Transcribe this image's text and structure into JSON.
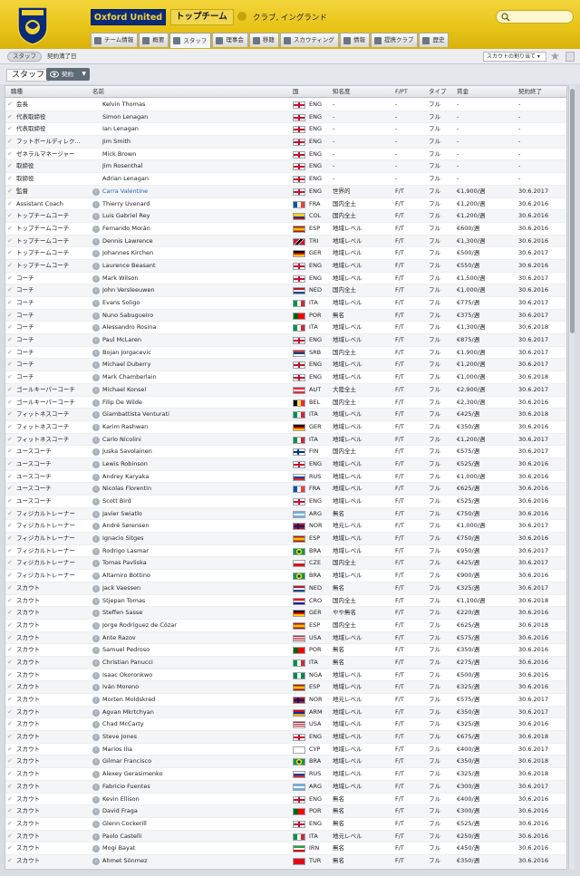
{
  "header": {
    "club_name": "Oxford United",
    "squad": "トップチーム",
    "club_sub": "クラブ, イングランド"
  },
  "tabs": [
    {
      "label": "チーム情報",
      "icon": "team-icon"
    },
    {
      "label": "概要",
      "icon": "overview-icon"
    },
    {
      "label": "スタッフ",
      "icon": "staff-icon",
      "active": true
    },
    {
      "label": "理事会",
      "icon": "board-icon"
    },
    {
      "label": "移籍",
      "icon": "transfer-icon"
    },
    {
      "label": "スカウティング",
      "icon": "scouting-icon"
    },
    {
      "label": "情報",
      "icon": "info-icon"
    },
    {
      "label": "提携クラブ",
      "icon": "affiliate-icon"
    },
    {
      "label": "歴史",
      "icon": "history-icon"
    }
  ],
  "toolbar": {
    "breadcrumb_staff": "スタッフ",
    "breadcrumb_contract": "契約満了日",
    "sort_label": "スカウトの割り当て ▾"
  },
  "page": {
    "title": "スタッフ",
    "view_button": "契約"
  },
  "columns": {
    "role": "職種",
    "name": "名前",
    "nat": "国",
    "rep": "知名度",
    "fp": "F/PT",
    "type": "タイプ",
    "wage": "賃金",
    "exp": "契約終了"
  },
  "colors": {
    "header_yellow": "#e8c418",
    "club_blue": "#0a2b78",
    "link_blue": "#1f5fbf"
  },
  "rows": [
    {
      "role": "会長",
      "name": "Kelvin Thomas",
      "nat": "ENG",
      "rep": "-",
      "fp": "-",
      "type": "フル",
      "wage": "-",
      "exp": "-",
      "info": false
    },
    {
      "role": "代表取締役",
      "name": "Simon Lenagan",
      "nat": "ENG",
      "rep": "-",
      "fp": "-",
      "type": "フル",
      "wage": "-",
      "exp": "-",
      "info": false
    },
    {
      "role": "代表取締役",
      "name": "Ian Lenagan",
      "nat": "ENG",
      "rep": "-",
      "fp": "-",
      "type": "フル",
      "wage": "-",
      "exp": "-",
      "info": false
    },
    {
      "role": "フットボールディレク...",
      "name": "Jim Smith",
      "nat": "ENG",
      "rep": "-",
      "fp": "-",
      "type": "フル",
      "wage": "-",
      "exp": "-",
      "info": false
    },
    {
      "role": "ゼネラルマネージャー",
      "name": "Mick Brown",
      "nat": "ENG",
      "rep": "-",
      "fp": "-",
      "type": "フル",
      "wage": "-",
      "exp": "-",
      "info": false
    },
    {
      "role": "取締役",
      "name": "Jim Rosenthal",
      "nat": "ENG",
      "rep": "-",
      "fp": "-",
      "type": "フル",
      "wage": "-",
      "exp": "-",
      "info": false
    },
    {
      "role": "取締役",
      "name": "Adrian Lenagan",
      "nat": "ENG",
      "rep": "-",
      "fp": "-",
      "type": "フル",
      "wage": "-",
      "exp": "-",
      "info": false
    },
    {
      "role": "監督",
      "name": "Carra Valentine",
      "nat": "ENG",
      "rep": "世界的",
      "fp": "F/T",
      "type": "フル",
      "wage": "€1,900/週",
      "exp": "30.6.2017",
      "info": true,
      "link": true
    },
    {
      "role": "Assistant Coach",
      "name": "Thierry Uvenard",
      "nat": "FRA",
      "rep": "国内全土",
      "fp": "F/T",
      "type": "フル",
      "wage": "€1,200/週",
      "exp": "30.6.2016",
      "info": true
    },
    {
      "role": "トップチームコーチ",
      "name": "Luis Gabriel Rey",
      "nat": "COL",
      "rep": "国内全土",
      "fp": "F/T",
      "type": "フル",
      "wage": "€1,200/週",
      "exp": "30.6.2016",
      "info": true
    },
    {
      "role": "トップチームコーチ",
      "name": "Fernando Morán",
      "nat": "ESP",
      "rep": "地域レベル",
      "fp": "F/T",
      "type": "フル",
      "wage": "€600/週",
      "exp": "30.6.2016",
      "info": true
    },
    {
      "role": "トップチームコーチ",
      "name": "Dennis Lawrence",
      "nat": "TRI",
      "rep": "地域レベル",
      "fp": "F/T",
      "type": "フル",
      "wage": "€1,300/週",
      "exp": "30.6.2016",
      "info": true
    },
    {
      "role": "トップチームコーチ",
      "name": "Johannes Kirchen",
      "nat": "GER",
      "rep": "地域レベル",
      "fp": "F/T",
      "type": "フル",
      "wage": "€500/週",
      "exp": "30.6.2017",
      "info": true
    },
    {
      "role": "トップチームコーチ",
      "name": "Laurence Beasant",
      "nat": "ENG",
      "rep": "地域レベル",
      "fp": "F/T",
      "type": "フル",
      "wage": "€550/週",
      "exp": "30.6.2016",
      "info": true
    },
    {
      "role": "コーチ",
      "name": "Mark Wilson",
      "nat": "ENG",
      "rep": "地域レベル",
      "fp": "F/T",
      "type": "フル",
      "wage": "€1,500/週",
      "exp": "30.6.2017",
      "info": true
    },
    {
      "role": "コーチ",
      "name": "John Versleeuwen",
      "nat": "NED",
      "rep": "国内全土",
      "fp": "F/T",
      "type": "フル",
      "wage": "€1,000/週",
      "exp": "30.6.2016",
      "info": true
    },
    {
      "role": "コーチ",
      "name": "Evans Soligo",
      "nat": "ITA",
      "rep": "地域レベル",
      "fp": "F/T",
      "type": "フル",
      "wage": "€775/週",
      "exp": "30.6.2017",
      "info": true
    },
    {
      "role": "コーチ",
      "name": "Nuno Sabugueiro",
      "nat": "POR",
      "rep": "無名",
      "fp": "F/T",
      "type": "フル",
      "wage": "€375/週",
      "exp": "30.6.2017",
      "info": true
    },
    {
      "role": "コーチ",
      "name": "Alessandro Rosina",
      "nat": "ITA",
      "rep": "地域レベル",
      "fp": "F/T",
      "type": "フル",
      "wage": "€1,300/週",
      "exp": "30.6.2018",
      "info": true
    },
    {
      "role": "コーチ",
      "name": "Paul McLaren",
      "nat": "ENG",
      "rep": "地域レベル",
      "fp": "F/T",
      "type": "フル",
      "wage": "€875/週",
      "exp": "30.6.2017",
      "info": true
    },
    {
      "role": "コーチ",
      "name": "Bojan Jorgacevic",
      "nat": "SRB",
      "rep": "国内全土",
      "fp": "F/T",
      "type": "フル",
      "wage": "€1,900/週",
      "exp": "30.6.2017",
      "info": true
    },
    {
      "role": "コーチ",
      "name": "Michael Duberry",
      "nat": "ENG",
      "rep": "地域レベル",
      "fp": "F/T",
      "type": "フル",
      "wage": "€1,200/週",
      "exp": "30.6.2017",
      "info": true
    },
    {
      "role": "コーチ",
      "name": "Mark Chamberlain",
      "nat": "ENG",
      "rep": "地域レベル",
      "fp": "F/T",
      "type": "フル",
      "wage": "€1,000/週",
      "exp": "30.6.2018",
      "info": true
    },
    {
      "role": "ゴールキーパーコーチ",
      "name": "Michael Konsel",
      "nat": "AUT",
      "rep": "大陸全土",
      "fp": "F/T",
      "type": "フル",
      "wage": "€2,900/週",
      "exp": "30.6.2017",
      "info": true
    },
    {
      "role": "ゴールキーパーコーチ",
      "name": "Filip De Wilde",
      "nat": "BEL",
      "rep": "国内全土",
      "fp": "F/T",
      "type": "フル",
      "wage": "€2,300/週",
      "exp": "30.6.2016",
      "info": true
    },
    {
      "role": "フィットネスコーチ",
      "name": "Giambattista Venturati",
      "nat": "ITA",
      "rep": "地域レベル",
      "fp": "F/T",
      "type": "フル",
      "wage": "€425/週",
      "exp": "30.6.2018",
      "info": true
    },
    {
      "role": "フィットネスコーチ",
      "name": "Karim Rashwan",
      "nat": "GER",
      "rep": "地域レベル",
      "fp": "F/T",
      "type": "フル",
      "wage": "€350/週",
      "exp": "30.6.2016",
      "info": true
    },
    {
      "role": "フィットネスコーチ",
      "name": "Carlo Nicolini",
      "nat": "ITA",
      "rep": "地域レベル",
      "fp": "F/T",
      "type": "フル",
      "wage": "€1,200/週",
      "exp": "30.6.2017",
      "info": true
    },
    {
      "role": "ユースコーチ",
      "name": "Juska Savolainen",
      "nat": "FIN",
      "rep": "国内全土",
      "fp": "F/T",
      "type": "フル",
      "wage": "€575/週",
      "exp": "30.6.2017",
      "info": true
    },
    {
      "role": "ユースコーチ",
      "name": "Lewis Robinson",
      "nat": "ENG",
      "rep": "地域レベル",
      "fp": "F/T",
      "type": "フル",
      "wage": "€525/週",
      "exp": "30.6.2016",
      "info": true
    },
    {
      "role": "ユースコーチ",
      "name": "Andrey Karyaka",
      "nat": "RUS",
      "rep": "地域レベル",
      "fp": "F/T",
      "type": "フル",
      "wage": "€1,000/週",
      "exp": "30.6.2016",
      "info": true
    },
    {
      "role": "ユースコーチ",
      "name": "Nicolas Florentin",
      "nat": "FRA",
      "rep": "地域レベル",
      "fp": "F/T",
      "type": "フル",
      "wage": "€625/週",
      "exp": "30.6.2016",
      "info": true
    },
    {
      "role": "ユースコーチ",
      "name": "Scott Bird",
      "nat": "ENG",
      "rep": "地域レベル",
      "fp": "F/T",
      "type": "フル",
      "wage": "€525/週",
      "exp": "30.6.2016",
      "info": true
    },
    {
      "role": "フィジカルトレーナー",
      "name": "Javier Swiatlo",
      "nat": "ARG",
      "rep": "無名",
      "fp": "F/T",
      "type": "フル",
      "wage": "€750/週",
      "exp": "30.6.2016",
      "info": true
    },
    {
      "role": "フィジカルトレーナー",
      "name": "André Sørensen",
      "nat": "NOR",
      "rep": "地元レベル",
      "fp": "F/T",
      "type": "フル",
      "wage": "€1,000/週",
      "exp": "30.6.2017",
      "info": true
    },
    {
      "role": "フィジカルトレーナー",
      "name": "Ignacio Sitges",
      "nat": "ESP",
      "rep": "地域レベル",
      "fp": "F/T",
      "type": "フル",
      "wage": "€750/週",
      "exp": "30.6.2016",
      "info": true
    },
    {
      "role": "フィジカルトレーナー",
      "name": "Rodrigo Lasmar",
      "nat": "BRA",
      "rep": "地域レベル",
      "fp": "F/T",
      "type": "フル",
      "wage": "€950/週",
      "exp": "30.6.2017",
      "info": true
    },
    {
      "role": "フィジカルトレーナー",
      "name": "Tomas Pavliska",
      "nat": "CZE",
      "rep": "国内全土",
      "fp": "F/T",
      "type": "フル",
      "wage": "€425/週",
      "exp": "30.6.2017",
      "info": true
    },
    {
      "role": "フィジカルトレーナー",
      "name": "Altamiro Bottino",
      "nat": "BRA",
      "rep": "地域レベル",
      "fp": "F/T",
      "type": "フル",
      "wage": "€900/週",
      "exp": "30.6.2016",
      "info": true
    },
    {
      "role": "スカウト",
      "name": "Jack Vaessen",
      "nat": "NED",
      "rep": "無名",
      "fp": "F/T",
      "type": "フル",
      "wage": "€325/週",
      "exp": "30.6.2017",
      "info": true
    },
    {
      "role": "スカウト",
      "name": "Stjepan Tomas",
      "nat": "CRO",
      "rep": "国内全土",
      "fp": "F/T",
      "type": "フル",
      "wage": "€1,100/週",
      "exp": "30.6.2018",
      "info": true
    },
    {
      "role": "スカウト",
      "name": "Steffen Sasse",
      "nat": "GER",
      "rep": "やや無名",
      "fp": "F/T",
      "type": "フル",
      "wage": "€220/週",
      "exp": "30.6.2016",
      "info": true
    },
    {
      "role": "スカウト",
      "name": "Jorge Rodríguez de Cózar",
      "nat": "ESP",
      "rep": "国内全土",
      "fp": "F/T",
      "type": "フル",
      "wage": "€625/週",
      "exp": "30.6.2018",
      "info": true
    },
    {
      "role": "スカウト",
      "name": "Ante Razov",
      "nat": "USA",
      "rep": "地域レベル",
      "fp": "F/T",
      "type": "フル",
      "wage": "€575/週",
      "exp": "30.6.2016",
      "info": true
    },
    {
      "role": "スカウト",
      "name": "Samuel Pedroso",
      "nat": "POR",
      "rep": "無名",
      "fp": "F/T",
      "type": "フル",
      "wage": "€350/週",
      "exp": "30.6.2016",
      "info": true
    },
    {
      "role": "スカウト",
      "name": "Christian Panucci",
      "nat": "ITA",
      "rep": "無名",
      "fp": "F/T",
      "type": "フル",
      "wage": "€275/週",
      "exp": "30.6.2016",
      "info": true
    },
    {
      "role": "スカウト",
      "name": "Isaac Okoronkwo",
      "nat": "NGA",
      "rep": "地域レベル",
      "fp": "F/T",
      "type": "フル",
      "wage": "€500/週",
      "exp": "30.6.2016",
      "info": true
    },
    {
      "role": "スカウト",
      "name": "Iván Moreno",
      "nat": "ESP",
      "rep": "地域レベル",
      "fp": "F/T",
      "type": "フル",
      "wage": "€325/週",
      "exp": "30.6.2016",
      "info": true
    },
    {
      "role": "スカウト",
      "name": "Morten Moldskred",
      "nat": "NOR",
      "rep": "地元レベル",
      "fp": "F/T",
      "type": "フル",
      "wage": "€575/週",
      "exp": "30.6.2017",
      "info": true
    },
    {
      "role": "スカウト",
      "name": "Agvan Mkrtchyan",
      "nat": "ARM",
      "rep": "地域レベル",
      "fp": "F/T",
      "type": "フル",
      "wage": "€350/週",
      "exp": "30.6.2017",
      "info": true
    },
    {
      "role": "スカウト",
      "name": "Chad McCarty",
      "nat": "USA",
      "rep": "地域レベル",
      "fp": "F/T",
      "type": "フル",
      "wage": "€325/週",
      "exp": "30.6.2016",
      "info": true
    },
    {
      "role": "スカウト",
      "name": "Steve Jones",
      "nat": "ENG",
      "rep": "地域レベル",
      "fp": "F/T",
      "type": "フル",
      "wage": "€675/週",
      "exp": "30.6.2018",
      "info": true
    },
    {
      "role": "スカウト",
      "name": "Marios Ilia",
      "nat": "CYP",
      "rep": "地域レベル",
      "fp": "F/T",
      "type": "フル",
      "wage": "€400/週",
      "exp": "30.6.2017",
      "info": true
    },
    {
      "role": "スカウト",
      "name": "Gilmar Francisco",
      "nat": "BRA",
      "rep": "地域レベル",
      "fp": "F/T",
      "type": "フル",
      "wage": "€350/週",
      "exp": "30.6.2018",
      "info": true
    },
    {
      "role": "スカウト",
      "name": "Alexey Gerasimenko",
      "nat": "RUS",
      "rep": "地域レベル",
      "fp": "F/T",
      "type": "フル",
      "wage": "€325/週",
      "exp": "30.6.2018",
      "info": true
    },
    {
      "role": "スカウト",
      "name": "Fabricio Fuentes",
      "nat": "ARG",
      "rep": "地域レベル",
      "fp": "F/T",
      "type": "フル",
      "wage": "€300/週",
      "exp": "30.6.2017",
      "info": true
    },
    {
      "role": "スカウト",
      "name": "Kevin Ellison",
      "nat": "ENG",
      "rep": "無名",
      "fp": "F/T",
      "type": "フル",
      "wage": "€400/週",
      "exp": "30.6.2016",
      "info": true
    },
    {
      "role": "スカウト",
      "name": "David Fraga",
      "nat": "POR",
      "rep": "無名",
      "fp": "F/T",
      "type": "フル",
      "wage": "€300/週",
      "exp": "30.6.2016",
      "info": true
    },
    {
      "role": "スカウト",
      "name": "Glenn Cockerill",
      "nat": "ENG",
      "rep": "無名",
      "fp": "F/T",
      "type": "フル",
      "wage": "€525/週",
      "exp": "30.6.2016",
      "info": true
    },
    {
      "role": "スカウト",
      "name": "Paolo Castelli",
      "nat": "ITA",
      "rep": "地元レベル",
      "fp": "F/T",
      "type": "フル",
      "wage": "€250/週",
      "exp": "30.6.2016",
      "info": true
    },
    {
      "role": "スカウト",
      "name": "Mogi Bayat",
      "nat": "IRN",
      "rep": "無名",
      "fp": "F/T",
      "type": "フル",
      "wage": "€450/週",
      "exp": "30.6.2016",
      "info": true
    },
    {
      "role": "スカウト",
      "name": "Ahmet Sönmez",
      "nat": "TUR",
      "rep": "無名",
      "fp": "F/T",
      "type": "フル",
      "wage": "€350/週",
      "exp": "30.6.2016",
      "info": true
    }
  ]
}
